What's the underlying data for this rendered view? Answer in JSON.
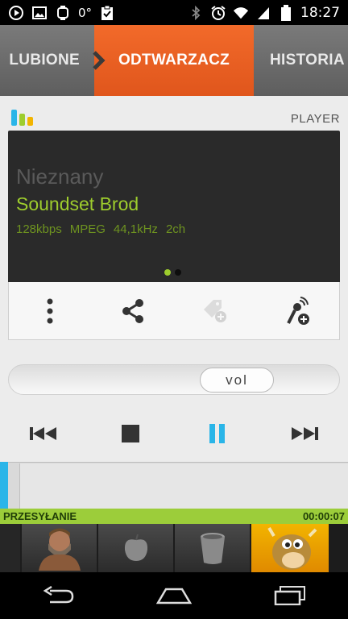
{
  "status_bar": {
    "left_icons": [
      "play-circle-icon",
      "image-icon",
      "watch-icon"
    ],
    "degree": "0°",
    "right_icons": [
      "bluetooth-icon",
      "alarm-icon",
      "wifi-icon",
      "signal-icon",
      "battery-icon"
    ],
    "time": "18:27"
  },
  "tabs": [
    {
      "label": "LUBIONE",
      "active": false
    },
    {
      "label": "ODTWARZACZ",
      "active": true
    },
    {
      "label": "HISTORIA",
      "active": false
    }
  ],
  "player": {
    "section_label": "PLAYER",
    "artist": "Nieznany",
    "title": "Soundset Brod",
    "meta": [
      "128kbps",
      "MPEG",
      "44,1kHz",
      "2ch"
    ],
    "page_count": 2,
    "page_active": 1
  },
  "actions": [
    {
      "icon": "more-vertical-icon"
    },
    {
      "icon": "share-icon"
    },
    {
      "icon": "tag-add-icon",
      "disabled": true
    },
    {
      "icon": "mic-add-icon"
    }
  ],
  "volume": {
    "label": "vol",
    "level": 0.72
  },
  "transport": [
    {
      "icon": "skip-previous-icon"
    },
    {
      "icon": "stop-icon"
    },
    {
      "icon": "pause-icon"
    },
    {
      "icon": "skip-next-icon"
    }
  ],
  "transfer": {
    "label": "PRZESYŁANIE",
    "time": "00:00:07"
  },
  "thumbnails": [
    "man-thumb",
    "apple-thumb",
    "bucket-thumb",
    "cow-thumb"
  ],
  "colors": {
    "accent_orange": "#f26a2a",
    "accent_green": "#9ecd2d",
    "accent_blue": "#2ab5e8"
  },
  "nav": [
    "back-icon",
    "home-icon",
    "recents-icon"
  ]
}
